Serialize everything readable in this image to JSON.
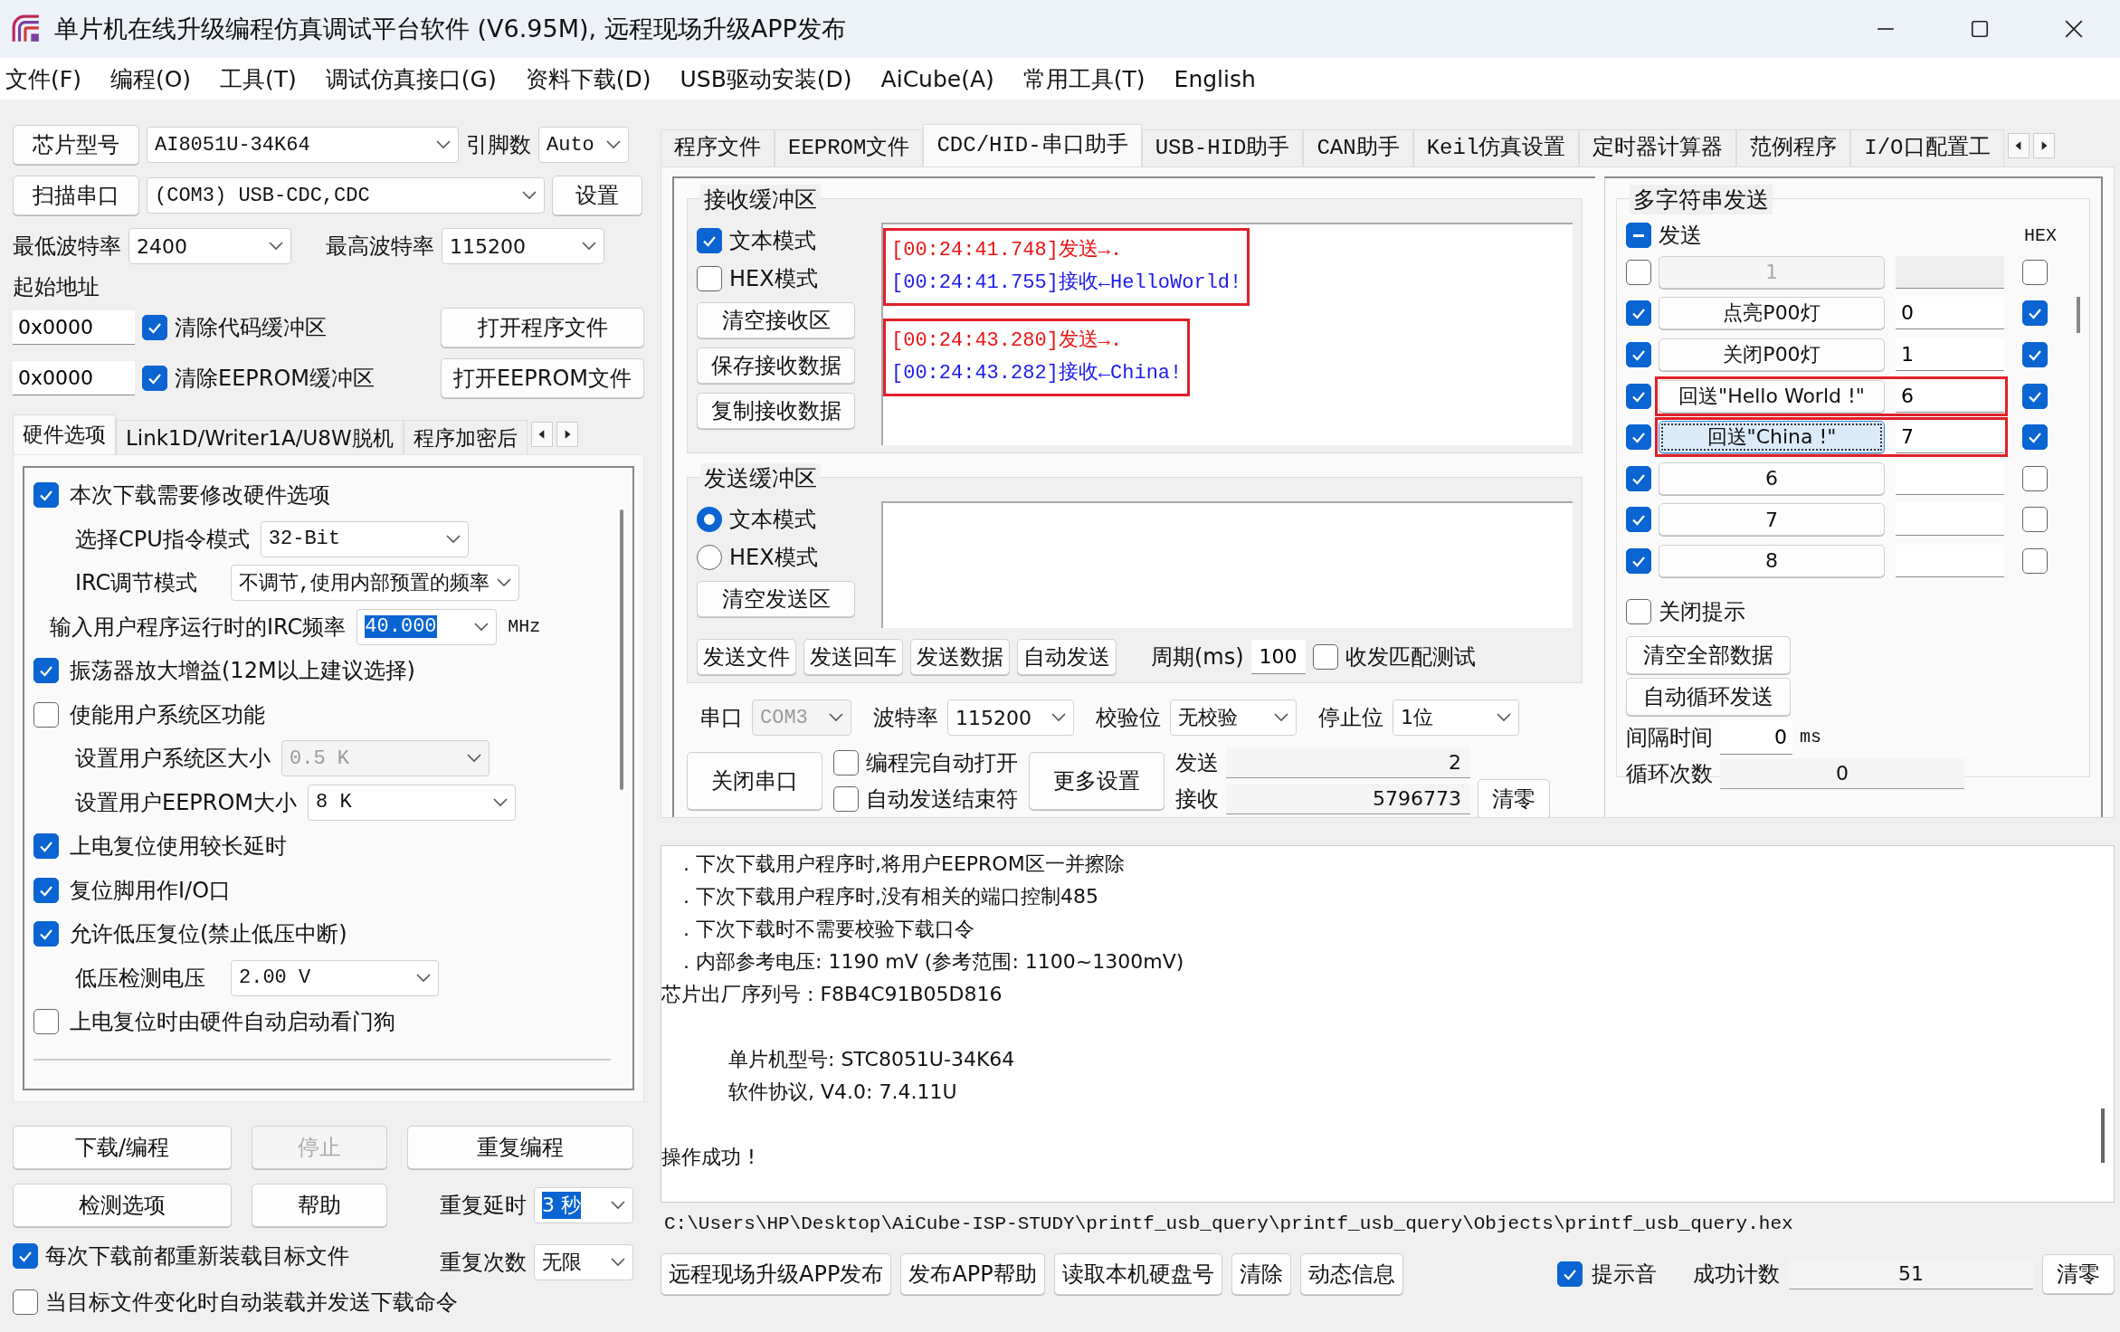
{
  "window": {
    "title": "单片机在线升级编程仿真调试平台软件 (V6.95M), 远程现场升级APP发布"
  },
  "menu": [
    {
      "label": "文件(F)"
    },
    {
      "label": "编程(O)"
    },
    {
      "label": "工具(T)"
    },
    {
      "label": "调试仿真接口(G)"
    },
    {
      "label": "资料下载(D)"
    },
    {
      "label": "USB驱动安装(D)"
    },
    {
      "label": "AiCube(A)"
    },
    {
      "label": "常用工具(T)"
    },
    {
      "label": "English"
    }
  ],
  "left": {
    "chip": {
      "button": "芯片型号",
      "value": "AI8051U-34K64"
    },
    "pins": {
      "label": "引脚数",
      "value": "Auto"
    },
    "port": {
      "button": "扫描串口",
      "value": "(COM3) USB-CDC,CDC",
      "settings": "设置"
    },
    "min_baud": {
      "label": "最低波特率",
      "value": "2400"
    },
    "max_baud": {
      "label": "最高波特率",
      "value": "115200"
    },
    "start_address": "起始地址",
    "address_rows": [
      {
        "value": "0x0000",
        "label": "清除代码缓冲区",
        "checked": true,
        "button": "打开程序文件"
      },
      {
        "value": "0x0000",
        "label": "清除EEPROM缓冲区",
        "checked": true,
        "button": "打开EEPROM文件"
      }
    ],
    "tabs": [
      {
        "label": "硬件选项",
        "selected": true
      },
      {
        "label": "Link1D/Writer1A/U8W脱机",
        "selected": false
      },
      {
        "label": "程序加密后",
        "selected": false
      }
    ],
    "hw_options": [
      {
        "kind": "checkbox",
        "label": "本次下载需要修改硬件选项",
        "checked": true
      },
      {
        "kind": "select",
        "label": "选择CPU指令模式",
        "value": "32-Bit",
        "disabled": false,
        "highlighted": false
      },
      {
        "kind": "select",
        "label": "IRC调节模式",
        "value": "不调节,使用内部预置的频率",
        "disabled": false,
        "highlighted": false
      },
      {
        "kind": "input",
        "label": "输入用户程序运行时的IRC频率",
        "value": "40.000",
        "unit": "MHz",
        "highlighted": true
      },
      {
        "kind": "checkbox",
        "label": "振荡器放大增益(12M以上建议选择)",
        "checked": true
      },
      {
        "kind": "checkbox",
        "label": "使能用户系统区功能",
        "checked": false
      },
      {
        "kind": "select",
        "label": "设置用户系统区大小",
        "value": "0.5 K",
        "disabled": true,
        "highlighted": false
      },
      {
        "kind": "select",
        "label": "设置用户EEPROM大小",
        "value": "8   K",
        "disabled": false,
        "highlighted": false
      },
      {
        "kind": "checkbox",
        "label": "上电复位使用较长延时",
        "checked": true
      },
      {
        "kind": "checkbox",
        "label": "复位脚用作I/O口",
        "checked": true
      },
      {
        "kind": "checkbox",
        "label": "允许低压复位(禁止低压中断)",
        "checked": true
      },
      {
        "kind": "select",
        "label": "低压检测电压",
        "value": "2.00 V",
        "disabled": false,
        "highlighted": false
      },
      {
        "kind": "checkbox",
        "label": "上电复位时由硬件自动启动看门狗",
        "checked": false
      }
    ],
    "actions": [
      {
        "label": "下载/编程",
        "disabled": false
      },
      {
        "label": "停止",
        "disabled": true
      },
      {
        "label": "重复编程",
        "disabled": false
      },
      {
        "label": "检测选项",
        "disabled": false
      },
      {
        "label": "帮助",
        "disabled": false
      }
    ],
    "repeat_delay": {
      "label": "重复延时",
      "value": "3 秒",
      "highlighted": true
    },
    "repeat_count": {
      "label": "重复次数",
      "value": "无限",
      "highlighted": false
    },
    "bottom_checks": [
      {
        "label": "每次下载前都重新装载目标文件",
        "checked": true
      },
      {
        "label": "当目标文件变化时自动装载并发送下载命令",
        "checked": false
      }
    ]
  },
  "right": {
    "tabs": [
      {
        "label": "程序文件",
        "selected": false
      },
      {
        "label": "EEPROM文件",
        "selected": false
      },
      {
        "label": "CDC/HID-串口助手",
        "selected": true
      },
      {
        "label": "USB-HID助手",
        "selected": false
      },
      {
        "label": "CAN助手",
        "selected": false
      },
      {
        "label": "Keil仿真设置",
        "selected": false
      },
      {
        "label": "定时器计算器",
        "selected": false
      },
      {
        "label": "范例程序",
        "selected": false
      },
      {
        "label": "I/O口配置工",
        "selected": false
      }
    ],
    "receive": {
      "title": "接收缓冲区",
      "modes": [
        {
          "label": "文本模式",
          "checked": true
        },
        {
          "label": "HEX模式",
          "checked": false
        }
      ],
      "buttons": [
        "清空接收区",
        "保存接收数据",
        "复制接收数据"
      ],
      "groups": [
        {
          "highlighted": true,
          "lines": [
            {
              "kind": "send",
              "text": "[00:24:41.748]发送→."
            },
            {
              "kind": "receive",
              "text": "[00:24:41.755]接收←HelloWorld!"
            }
          ]
        },
        {
          "highlighted": true,
          "lines": [
            {
              "kind": "send",
              "text": "[00:24:43.280]发送→."
            },
            {
              "kind": "receive",
              "text": "[00:24:43.282]接收←China!"
            }
          ]
        }
      ]
    },
    "send": {
      "title": "发送缓冲区",
      "modes": [
        {
          "label": "文本模式",
          "selected": true
        },
        {
          "label": "HEX模式",
          "selected": false
        }
      ],
      "clear": "清空发送区",
      "actions": [
        "发送文件",
        "发送回车",
        "发送数据",
        "自动发送"
      ],
      "period": {
        "label": "周期(ms)",
        "value": "100"
      },
      "match_test": {
        "label": "收发匹配测试",
        "checked": false
      }
    },
    "serial": [
      {
        "label": "串口",
        "value": "COM3",
        "disabled": true
      },
      {
        "label": "波特率",
        "value": "115200",
        "disabled": false
      },
      {
        "label": "校验位",
        "value": "无校验",
        "disabled": false
      },
      {
        "label": "停止位",
        "value": "1位",
        "disabled": false
      }
    ],
    "close_port": "关闭串口",
    "port_options": [
      {
        "label": "编程完自动打开",
        "checked": false
      },
      {
        "label": "自动发送结束符",
        "checked": false
      }
    ],
    "more_settings": "更多设置",
    "counters": [
      {
        "label": "发送",
        "value": "2"
      },
      {
        "label": "接收",
        "value": "5796773"
      }
    ],
    "counters_clear": "清零",
    "multi": {
      "title": "多字符串发送",
      "send_all": {
        "label": "发送",
        "indeterminate": true
      },
      "hex_header": "HEX",
      "rows": [
        {
          "checked": false,
          "label": "1",
          "disabled": true,
          "hex": false,
          "highlighted": false,
          "focused": false
        },
        {
          "checked": true,
          "label": "点亮P00灯",
          "value": "0",
          "disabled": false,
          "hex": true,
          "highlighted": false,
          "focused": false
        },
        {
          "checked": true,
          "label": "关闭P00灯",
          "value": "1",
          "disabled": false,
          "hex": true,
          "highlighted": false,
          "focused": false
        },
        {
          "checked": true,
          "label": "回送\"Hello World !\"",
          "value": "6",
          "disabled": false,
          "hex": true,
          "highlighted": true,
          "focused": false
        },
        {
          "checked": true,
          "label": "回送\"China !\"",
          "value": "7",
          "disabled": false,
          "hex": true,
          "highlighted": true,
          "focused": true
        },
        {
          "checked": true,
          "label": "6",
          "disabled": false,
          "hex": false,
          "highlighted": false,
          "focused": false
        },
        {
          "checked": true,
          "label": "7",
          "disabled": false,
          "hex": false,
          "highlighted": false,
          "focused": false
        },
        {
          "checked": true,
          "label": "8",
          "disabled": false,
          "hex": false,
          "highlighted": false,
          "focused": false
        }
      ],
      "close_tips": {
        "label": "关闭提示",
        "checked": false
      },
      "buttons": [
        "清空全部数据",
        "自动循环发送"
      ],
      "interval": {
        "label": "间隔时间",
        "value": "0",
        "unit": "ms"
      },
      "loop_count": {
        "label": "循环次数",
        "value": "0"
      }
    }
  },
  "log": [
    {
      "kind": "bullet",
      "text": ". 下次下载用户程序时,将用户EEPROM区一并擦除"
    },
    {
      "kind": "bullet",
      "text": ". 下次下载用户程序时,没有相关的端口控制485"
    },
    {
      "kind": "bullet",
      "text": ". 下次下载时不需要校验下载口令"
    },
    {
      "kind": "bullet",
      "text": ". 内部参考电压: 1190 mV (参考范围: 1100~1300mV)"
    },
    {
      "kind": "plain",
      "text": "芯片出厂序列号 : F8B4C91B05D816"
    },
    {
      "kind": "blank"
    },
    {
      "kind": "indented",
      "text": "单片机型号: STC8051U-34K64"
    },
    {
      "kind": "indented",
      "text": "软件协议, V4.0: 7.4.11U"
    },
    {
      "kind": "blank"
    },
    {
      "kind": "plain",
      "text": "操作成功 !"
    }
  ],
  "path": "C:\\Users\\HP\\Desktop\\AiCube-ISP-STUDY\\printf_usb_query\\printf_usb_query\\Objects\\printf_usb_query.hex",
  "footer": {
    "buttons": [
      "远程现场升级APP发布",
      "发布APP帮助",
      "读取本机硬盘号",
      "清除",
      "动态信息"
    ],
    "beep": {
      "label": "提示音",
      "checked": true
    },
    "success": {
      "label": "成功计数",
      "value": "51"
    },
    "clear": "清零"
  }
}
